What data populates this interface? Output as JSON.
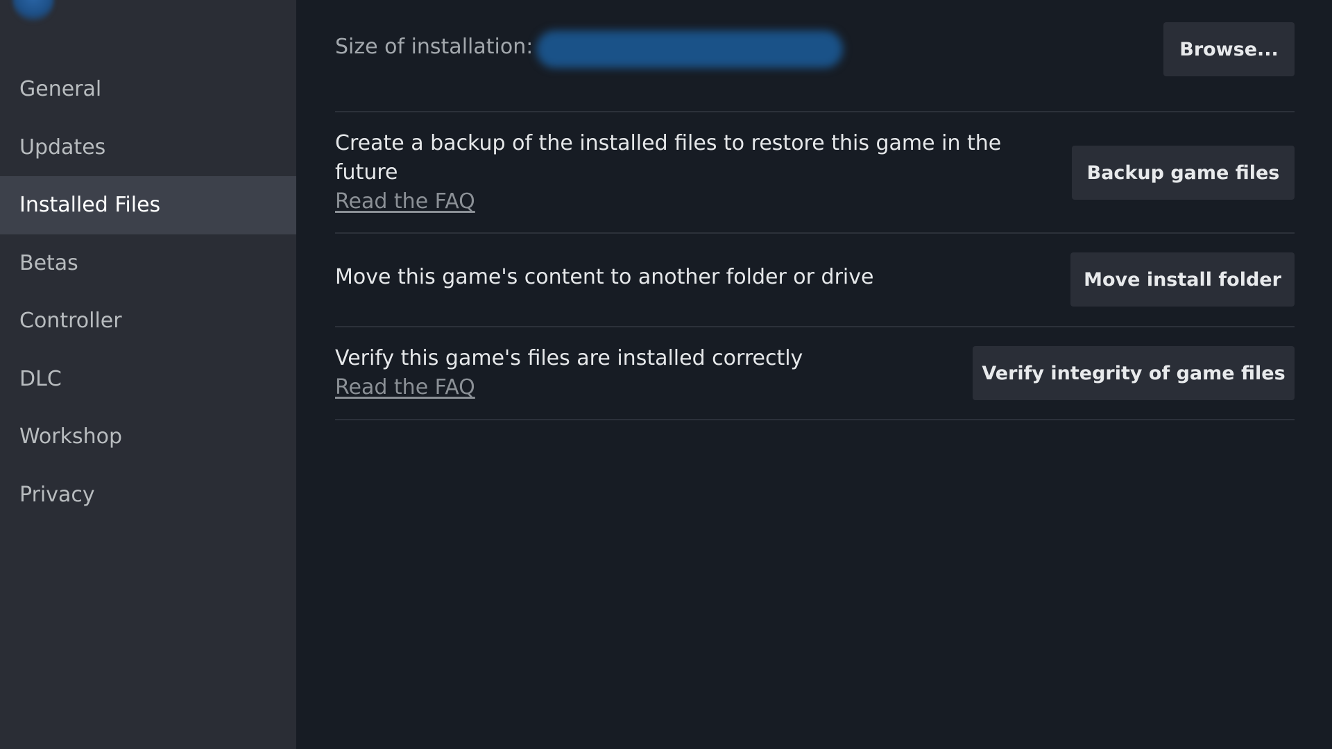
{
  "sidebar": {
    "items": [
      {
        "label": "General",
        "active": false
      },
      {
        "label": "Updates",
        "active": false
      },
      {
        "label": "Installed Files",
        "active": true
      },
      {
        "label": "Betas",
        "active": false
      },
      {
        "label": "Controller",
        "active": false
      },
      {
        "label": "DLC",
        "active": false
      },
      {
        "label": "Workshop",
        "active": false
      },
      {
        "label": "Privacy",
        "active": false
      }
    ]
  },
  "main": {
    "size": {
      "label": "Size of installation:",
      "value_redacted": true,
      "browse_label": "Browse..."
    },
    "backup": {
      "description": "Create a backup of the installed files to restore this game in the future",
      "faq_label": "Read the FAQ",
      "button_label": "Backup game files"
    },
    "move": {
      "description": "Move this game's content to another folder or drive",
      "button_label": "Move install folder"
    },
    "verify": {
      "description": "Verify this game's files are installed correctly",
      "faq_label": "Read the FAQ",
      "button_label": "Verify integrity of game files"
    }
  },
  "colors": {
    "sidebar_bg": "#2a2d35",
    "sidebar_active_bg": "#3d414b",
    "main_bg": "#171c24",
    "button_bg": "#2a2e37",
    "divider": "#2c313a",
    "redaction": "#1a5288"
  }
}
